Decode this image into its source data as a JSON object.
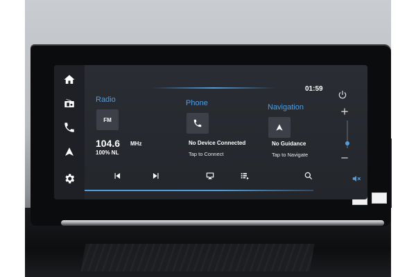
{
  "clock": "01:59",
  "sidebar": {
    "items": [
      {
        "icon": "home-icon"
      },
      {
        "icon": "radio-icon"
      },
      {
        "icon": "phone-icon"
      },
      {
        "icon": "navigation-icon"
      },
      {
        "icon": "gear-icon"
      }
    ]
  },
  "radio": {
    "title": "Radio",
    "band": "FM",
    "frequency": "104.6",
    "unit": "MHz",
    "station": "100% NL"
  },
  "phone": {
    "title": "Phone",
    "status": "No Device Connected",
    "action": "Tap to Connect"
  },
  "navigation": {
    "title": "Navigation",
    "status": "No Guidance",
    "action": "Tap to Navigate"
  },
  "colors": {
    "accent": "#4f9fe0",
    "screen_bg": "#23262b",
    "tile_bg": "#3d4048",
    "bezel": "#0b0c0e"
  }
}
